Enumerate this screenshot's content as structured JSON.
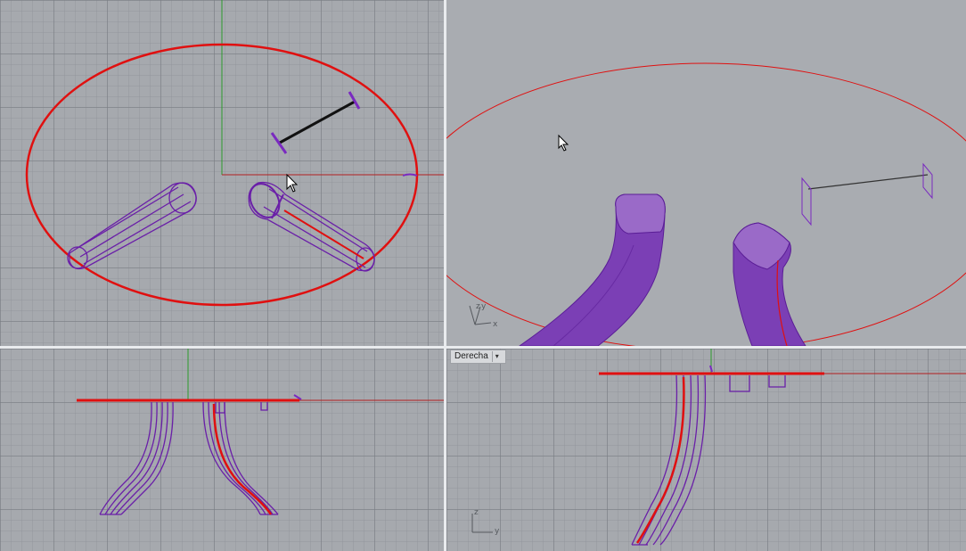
{
  "viewports": {
    "top": {},
    "perspective": {},
    "front": {},
    "right": {
      "label": "Derecha",
      "dropdown_glyph": "▾"
    }
  },
  "axis_labels": {
    "z": "z",
    "y": "y",
    "x": "x"
  },
  "colors": {
    "curve_red": "#e01010",
    "object_purple": "#6a1fa8",
    "line_black": "#111111",
    "grid_bg": "#a6a9ae"
  }
}
